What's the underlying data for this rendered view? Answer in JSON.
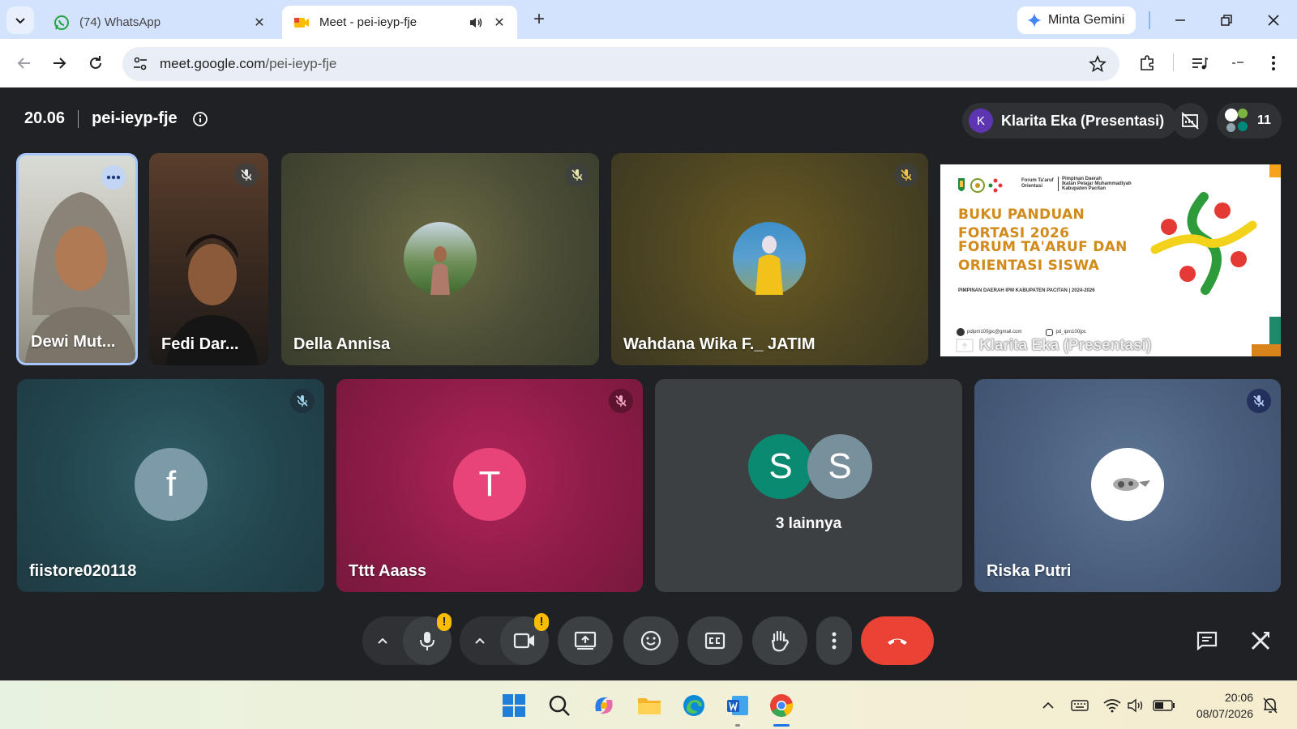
{
  "browser": {
    "tabs": [
      {
        "label": "(74) WhatsApp",
        "active": false,
        "icon": "whatsapp-icon"
      },
      {
        "label": "Meet - pei-ieyp-fje",
        "active": true,
        "icon": "meet-icon",
        "playing_audio": true
      }
    ],
    "gemini_label": "Minta Gemini",
    "url_host": "meet.google.com",
    "url_path": "/pei-ieyp-fje"
  },
  "meet": {
    "time": "20.06",
    "meeting_code": "pei-ieyp-fje",
    "presenter_initial": "K",
    "presenter_label": "Klarita Eka (Presentasi)",
    "participant_count": "11",
    "top_row": [
      {
        "name": "Dewi Mut...",
        "muted": false,
        "type": "camera",
        "active_speaker": true
      },
      {
        "name": "Fedi Dar...",
        "muted": true,
        "type": "camera"
      },
      {
        "name": "Della Annisa",
        "muted": true,
        "type": "photo"
      },
      {
        "name": "Wahdana Wika F._ JATIM",
        "muted": true,
        "type": "photo"
      }
    ],
    "presentation": {
      "owner_label": "Klarita Eka (Presentasi)",
      "header_left": "Forum Ta'aruf Orientasi",
      "header_right_1": "Pimpinan Daerah",
      "header_right_2": "Ikatan Pelajar Muhammadiyah",
      "header_right_3": "Kabupaten Pacitan",
      "title_line1": "BUKU PANDUAN",
      "title_line2": "FORTASI 2026",
      "title_line3": "FORUM TA'ARUF DAN",
      "title_line4": "ORIENTASI SISWA",
      "subtitle": "PIMPINAN DAERAH IPM KABUPATEN PACITAN | 2024-2026",
      "email": "pdipm100jpc@gmail.com",
      "instagram": "pd_ipm100jpc"
    },
    "bottom_row": [
      {
        "name": "fiistore020118",
        "initial": "f",
        "muted": true,
        "color": "#7d9aa8"
      },
      {
        "name": "Tttt Aaass",
        "initial": "T",
        "muted": true,
        "color": "#e8447a"
      },
      {
        "group_initials": [
          "S",
          "S"
        ],
        "label": "3 lainnya"
      },
      {
        "name": "Riska Putri",
        "muted": true
      }
    ],
    "colors": {
      "hangup": "#ea4335",
      "warning": "#fbbc04",
      "accent": "#8ab4f8"
    }
  },
  "taskbar": {
    "time": "20:06",
    "date": "08/07/2026"
  }
}
